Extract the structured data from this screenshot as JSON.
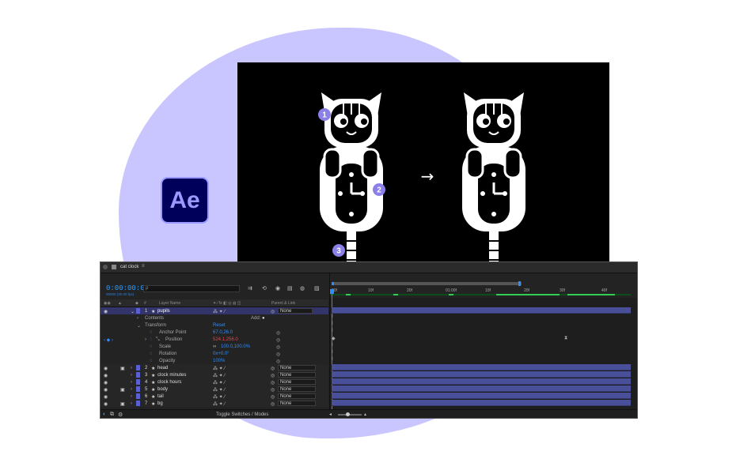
{
  "badges": {
    "one": "1",
    "two": "2",
    "three": "3"
  },
  "arrow": "→",
  "logo": {
    "text": "Ae"
  },
  "window": {
    "title": "cat clock",
    "menu_icon": "≡"
  },
  "timecode": "0:00:00:00",
  "fps": "00000 (30.00 fps)",
  "search": {
    "icon": "ρ"
  },
  "columns": {
    "label": "#",
    "layer_name": "Layer Name",
    "parent": "Parent & Link"
  },
  "ruler": [
    "00f",
    "10f",
    "20f",
    "01:00f",
    "10f",
    "20f",
    "30f",
    "40f"
  ],
  "layers_top": {
    "num": "1",
    "name": "pupils",
    "parent": "None"
  },
  "contents": {
    "label": "Contents",
    "add": "Add:"
  },
  "transform": {
    "label": "Transform",
    "reset": "Reset"
  },
  "props": [
    {
      "name": "Anchor Point",
      "value": "67.0,26.0"
    },
    {
      "name": "Position",
      "value": "524.1,256.0"
    },
    {
      "name": "Scale",
      "value": "100.0,100.0%"
    },
    {
      "name": "Rotation",
      "value": "0x+0.0°"
    },
    {
      "name": "Opacity",
      "value": "100%"
    }
  ],
  "layers": [
    {
      "num": "2",
      "name": "head",
      "parent": "None"
    },
    {
      "num": "3",
      "name": "clock minutes",
      "parent": "None"
    },
    {
      "num": "4",
      "name": "clock hours",
      "parent": "None"
    },
    {
      "num": "5",
      "name": "body",
      "parent": "None"
    },
    {
      "num": "6",
      "name": "tail",
      "parent": "None"
    },
    {
      "num": "7",
      "name": "bg",
      "parent": "None"
    }
  ],
  "footer": {
    "toggle": "Toggle Switches / Modes"
  },
  "colors": {
    "accent": "#2d8cff",
    "layer_label": "#5a5fd1",
    "blob": "#c9c5ff",
    "ae_bg": "#00005b",
    "ae_fg": "#9999ff"
  }
}
